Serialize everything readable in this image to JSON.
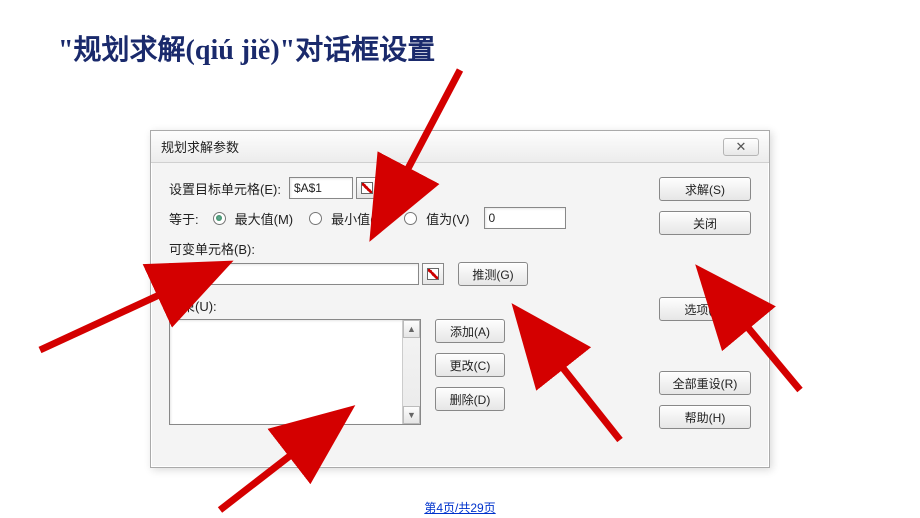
{
  "slide": {
    "title_prefix": "\"规划求解",
    "title_pinyin": "(qiú jiě)",
    "title_suffix": "\"对话框设置"
  },
  "dialog": {
    "title": "规划求解参数",
    "close_glyph": "✕",
    "target_label": "设置目标单元格(E):",
    "target_value": "$A$1",
    "equal_label": "等于:",
    "radio_max": "最大值(M)",
    "radio_min": "最小值(N)",
    "radio_value": "值为(V)",
    "value_input": "0",
    "changing_label": "可变单元格(B):",
    "constraints_label": "约束(U):",
    "buttons": {
      "solve": "求解(S)",
      "close": "关闭",
      "guess": "推测(G)",
      "options": "选项(O)",
      "add": "添加(A)",
      "change": "更改(C)",
      "delete": "删除(D)",
      "reset": "全部重设(R)",
      "help": "帮助(H)"
    }
  },
  "footer": {
    "page": "第4页/共29页"
  }
}
